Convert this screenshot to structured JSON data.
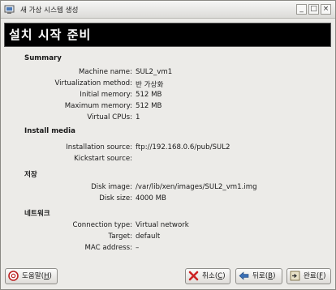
{
  "window": {
    "title": "새 가상 시스템 생성"
  },
  "titlebar_buttons": {
    "minimize": "_",
    "maximize": "□",
    "close": "×"
  },
  "banner": {
    "text": "설치 시작 준비"
  },
  "sections": {
    "summary": {
      "heading": "Summary"
    },
    "install_media": {
      "heading": "Install media"
    },
    "storage": {
      "heading": "저장"
    },
    "network": {
      "heading": "네트워크"
    }
  },
  "summary": {
    "machine_name": {
      "label": "Machine name:",
      "value": "SUL2_vm1"
    },
    "virtualization_method": {
      "label": "Virtualization method:",
      "value": "반 가상화"
    },
    "initial_memory": {
      "label": "Initial memory:",
      "value": "512 MB"
    },
    "maximum_memory": {
      "label": "Maximum memory:",
      "value": "512 MB"
    },
    "virtual_cpus": {
      "label": "Virtual CPUs:",
      "value": "1"
    }
  },
  "install_media": {
    "installation_source": {
      "label": "Installation source:",
      "value": "ftp://192.168.0.6/pub/SUL2"
    },
    "kickstart_source": {
      "label": "Kickstart source:",
      "value": ""
    }
  },
  "storage": {
    "disk_image": {
      "label": "Disk image:",
      "value": "/var/lib/xen/images/SUL2_vm1.img"
    },
    "disk_size": {
      "label": "Disk size:",
      "value": "4000 MB"
    }
  },
  "network": {
    "connection_type": {
      "label": "Connection type:",
      "value": "Virtual network"
    },
    "target": {
      "label": "Target:",
      "value": "default"
    },
    "mac_address": {
      "label": "MAC address:",
      "value": "–"
    }
  },
  "buttons": {
    "help": {
      "text": "도움말(",
      "mnemonic": "H",
      "close": ")"
    },
    "cancel": {
      "text": "취소(",
      "mnemonic": "C",
      "close": ")"
    },
    "back": {
      "text": "뒤로(",
      "mnemonic": "B",
      "close": ")"
    },
    "finish": {
      "text": "완료(",
      "mnemonic": "F",
      "close": ")"
    }
  },
  "colors": {
    "banner_bg": "#000000",
    "banner_text": "#ffffff",
    "window_bg": "#ecebe8"
  }
}
